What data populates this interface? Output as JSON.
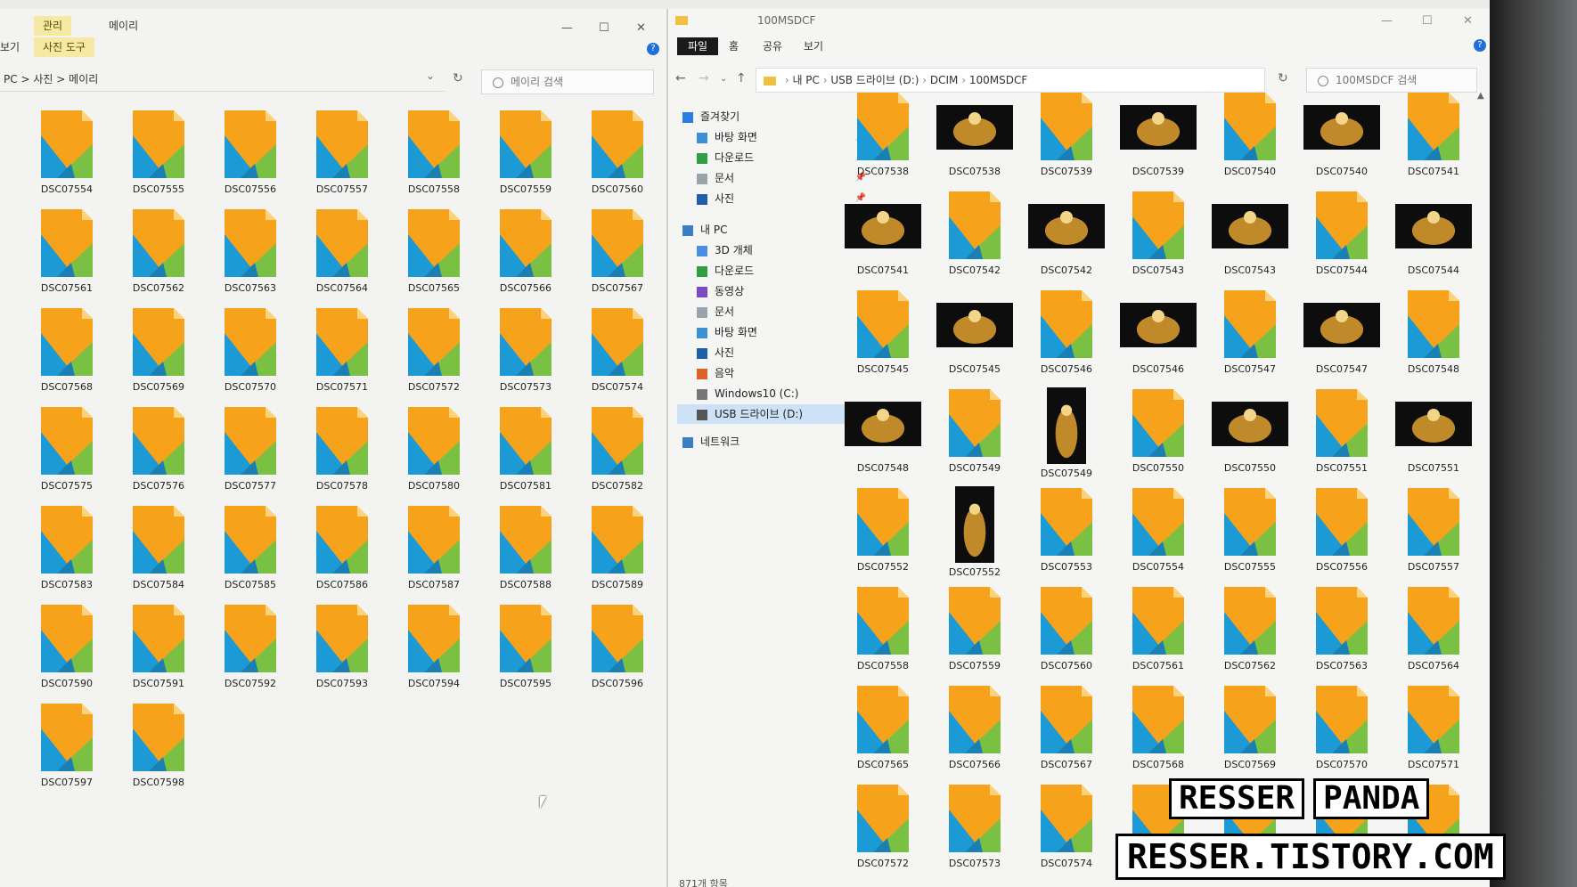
{
  "left_window": {
    "ribbon_tabs": {
      "manage": "관리",
      "folder": "메이리"
    },
    "ribbon_sub": {
      "view": "보기",
      "tools": "사진 도구"
    },
    "address": {
      "pc": "PC",
      "sep": ">",
      "pictures": "사진",
      "folder": "메이리"
    },
    "search_placeholder": "메이리 검색",
    "files": [
      "DSC07554",
      "DSC07555",
      "DSC07556",
      "DSC07557",
      "DSC07558",
      "DSC07559",
      "DSC07560",
      "DSC07561",
      "DSC07562",
      "DSC07563",
      "DSC07564",
      "DSC07565",
      "DSC07566",
      "DSC07567",
      "DSC07568",
      "DSC07569",
      "DSC07570",
      "DSC07571",
      "DSC07572",
      "DSC07573",
      "DSC07574",
      "DSC07575",
      "DSC07576",
      "DSC07577",
      "DSC07578",
      "DSC07580",
      "DSC07581",
      "DSC07582",
      "DSC07583",
      "DSC07584",
      "DSC07585",
      "DSC07586",
      "DSC07587",
      "DSC07588",
      "DSC07589",
      "DSC07590",
      "DSC07591",
      "DSC07592",
      "DSC07593",
      "DSC07594",
      "DSC07595",
      "DSC07596",
      "DSC07597",
      "DSC07598"
    ]
  },
  "right_window": {
    "title": "100MSDCF",
    "tabs": [
      "파일",
      "홈",
      "공유",
      "보기"
    ],
    "path": [
      "내 PC",
      "USB 드라이브 (D:)",
      "DCIM",
      "100MSDCF"
    ],
    "search_placeholder": "100MSDCF 검색",
    "sidebar": [
      {
        "label": "즐겨찾기",
        "icon": "star-icon",
        "pinned": false
      },
      {
        "label": "바탕 화면",
        "icon": "desktop-icon",
        "pinned": true
      },
      {
        "label": "다운로드",
        "icon": "download-icon",
        "pinned": true
      },
      {
        "label": "문서",
        "icon": "document-icon",
        "pinned": true
      },
      {
        "label": "사진",
        "icon": "pictures-icon",
        "pinned": true
      },
      {
        "label": "내 PC",
        "icon": "pc-icon",
        "pinned": false
      },
      {
        "label": "3D 개체",
        "icon": "cube-icon",
        "pinned": false
      },
      {
        "label": "다운로드",
        "icon": "download-icon",
        "pinned": false
      },
      {
        "label": "동영상",
        "icon": "video-icon",
        "pinned": false
      },
      {
        "label": "문서",
        "icon": "document-icon",
        "pinned": false
      },
      {
        "label": "바탕 화면",
        "icon": "desktop-icon",
        "pinned": false
      },
      {
        "label": "사진",
        "icon": "pictures-icon",
        "pinned": false
      },
      {
        "label": "음악",
        "icon": "music-icon",
        "pinned": false
      },
      {
        "label": "Windows10 (C:)",
        "icon": "drive-icon",
        "pinned": false
      },
      {
        "label": "USB 드라이브 (D:)",
        "icon": "usb-icon",
        "pinned": false,
        "selected": true
      },
      {
        "label": "네트워크",
        "icon": "network-icon",
        "pinned": false
      }
    ],
    "files": [
      {
        "name": "DSC07538",
        "t": "raw"
      },
      {
        "name": "DSC07538",
        "t": "photo"
      },
      {
        "name": "DSC07539",
        "t": "raw"
      },
      {
        "name": "DSC07539",
        "t": "photo"
      },
      {
        "name": "DSC07540",
        "t": "raw"
      },
      {
        "name": "DSC07540",
        "t": "photo"
      },
      {
        "name": "DSC07541",
        "t": "raw"
      },
      {
        "name": "DSC07541",
        "t": "photo"
      },
      {
        "name": "DSC07542",
        "t": "raw"
      },
      {
        "name": "DSC07542",
        "t": "photo"
      },
      {
        "name": "DSC07543",
        "t": "raw"
      },
      {
        "name": "DSC07543",
        "t": "photo"
      },
      {
        "name": "DSC07544",
        "t": "raw"
      },
      {
        "name": "DSC07544",
        "t": "photo"
      },
      {
        "name": "DSC07545",
        "t": "raw"
      },
      {
        "name": "DSC07545",
        "t": "photo"
      },
      {
        "name": "DSC07546",
        "t": "raw"
      },
      {
        "name": "DSC07546",
        "t": "photo"
      },
      {
        "name": "DSC07547",
        "t": "raw"
      },
      {
        "name": "DSC07547",
        "t": "photo"
      },
      {
        "name": "DSC07548",
        "t": "raw"
      },
      {
        "name": "DSC07548",
        "t": "photo"
      },
      {
        "name": "DSC07549",
        "t": "raw"
      },
      {
        "name": "DSC07549",
        "t": "tall"
      },
      {
        "name": "DSC07550",
        "t": "raw"
      },
      {
        "name": "DSC07550",
        "t": "photo"
      },
      {
        "name": "DSC07551",
        "t": "raw"
      },
      {
        "name": "DSC07551",
        "t": "photo"
      },
      {
        "name": "DSC07552",
        "t": "raw"
      },
      {
        "name": "DSC07552",
        "t": "tall"
      },
      {
        "name": "DSC07553",
        "t": "raw"
      },
      {
        "name": "DSC07554",
        "t": "raw"
      },
      {
        "name": "DSC07555",
        "t": "raw"
      },
      {
        "name": "DSC07556",
        "t": "raw"
      },
      {
        "name": "DSC07557",
        "t": "raw"
      },
      {
        "name": "DSC07558",
        "t": "raw"
      },
      {
        "name": "DSC07559",
        "t": "raw"
      },
      {
        "name": "DSC07560",
        "t": "raw"
      },
      {
        "name": "DSC07561",
        "t": "raw"
      },
      {
        "name": "DSC07562",
        "t": "raw"
      },
      {
        "name": "DSC07563",
        "t": "raw"
      },
      {
        "name": "DSC07564",
        "t": "raw"
      },
      {
        "name": "DSC07565",
        "t": "raw"
      },
      {
        "name": "DSC07566",
        "t": "raw"
      },
      {
        "name": "DSC07567",
        "t": "raw"
      },
      {
        "name": "DSC07568",
        "t": "raw"
      },
      {
        "name": "DSC07569",
        "t": "raw"
      },
      {
        "name": "DSC07570",
        "t": "raw"
      },
      {
        "name": "DSC07571",
        "t": "raw"
      },
      {
        "name": "DSC07572",
        "t": "raw"
      },
      {
        "name": "DSC07573",
        "t": "raw"
      },
      {
        "name": "DSC07574",
        "t": "raw"
      },
      {
        "name": "",
        "t": "raw"
      },
      {
        "name": "",
        "t": "raw"
      },
      {
        "name": "",
        "t": "raw"
      },
      {
        "name": "",
        "t": "raw"
      }
    ],
    "status": "871개 항목"
  },
  "watermark": {
    "word1": "RESSER",
    "word2": "PANDA",
    "url": "RESSER.TISTORY.COM"
  },
  "colors": {
    "accent": "#1e6fd9",
    "file_orange": "#f7a21b",
    "file_blue": "#1b9ad6",
    "file_green": "#7ac143"
  }
}
